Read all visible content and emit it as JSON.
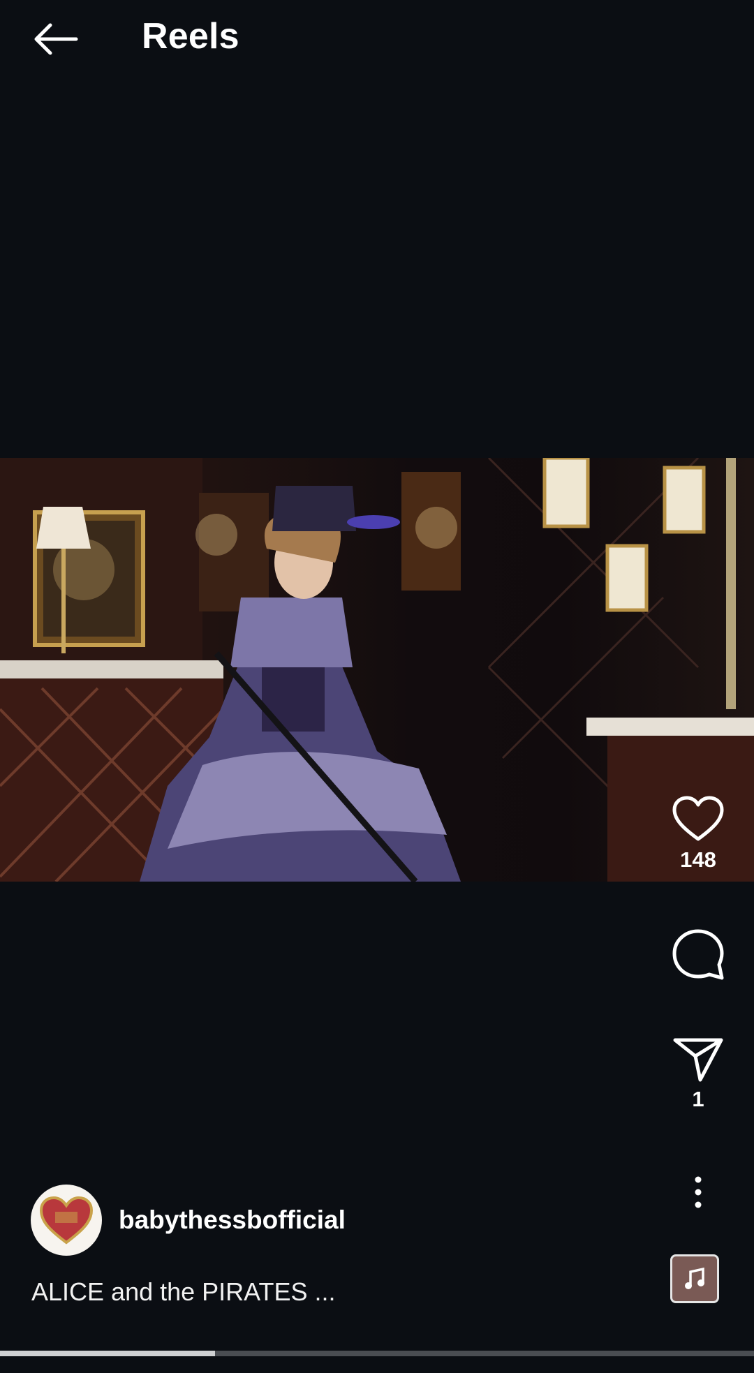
{
  "header": {
    "title": "Reels"
  },
  "reel": {
    "like_count": "148",
    "share_count": "1",
    "author": "babythessbofficial",
    "caption": "ALICE and the PIRATES ...",
    "progress": 0.285
  }
}
